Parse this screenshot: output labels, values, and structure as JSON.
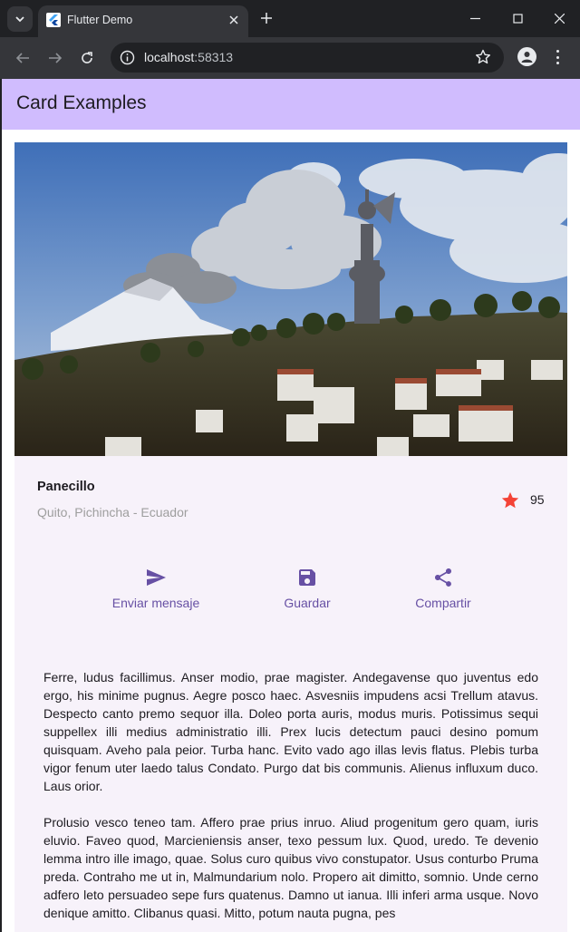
{
  "browser": {
    "tab_title": "Flutter Demo",
    "url_host": "localhost",
    "url_port": ":58313"
  },
  "app": {
    "title": "Card Examples"
  },
  "card": {
    "image_alt": "Panecillo Virgin statue overlooking Quito with erupting volcano",
    "place_name": "Panecillo",
    "place_location": "Quito, Pichincha - Ecuador",
    "rating": "95",
    "actions": [
      {
        "label": "Enviar mensaje",
        "icon": "send-icon"
      },
      {
        "label": "Guardar",
        "icon": "save-icon"
      },
      {
        "label": "Compartir",
        "icon": "share-icon"
      }
    ],
    "paragraphs": [
      "Ferre, ludus facillimus. Anser modio, prae magister. Andegavense quo juventus edo ergo, his minime pugnus. Aegre posco haec. Asvesniis impudens acsi Trellum atavus. Despecto canto premo sequor illa. Doleo porta auris, modus muris. Potissimus sequi suppellex illi medius administratio illi. Prex lucis detectum pauci desino pomum quisquam. Aveho pala peior. Turba hanc. Evito vado ago illas levis flatus. Plebis turba vigor fenum uter laedo talus Condato. Purgo dat bis communis. Alienus influxum duco. Laus orior.",
      "Prolusio vesco teneo tam. Affero prae prius inruo. Aliud progenitum gero quam, iuris eluvio. Faveo quod, Marcieniensis anser, texo pessum lux. Quod, uredo. Te devenio lemma intro ille imago, quae. Solus curo quibus vivo constupator. Usus conturbo Pruma preda. Contraho me ut in, Malmundarium nolo. Propero ait dimitto, somnio. Unde cerno adfero leto persuadeo sepe furs quatenus. Damno ut ianua. Illi inferi arma usque. Novo denique amitto. Clibanus quasi. Mitto, potum nauta pugna, pes"
    ]
  },
  "colors": {
    "appbar": "#d0bcfe",
    "card_bg": "#f7f2fa",
    "accent": "#6750a4",
    "star": "#f44336"
  }
}
